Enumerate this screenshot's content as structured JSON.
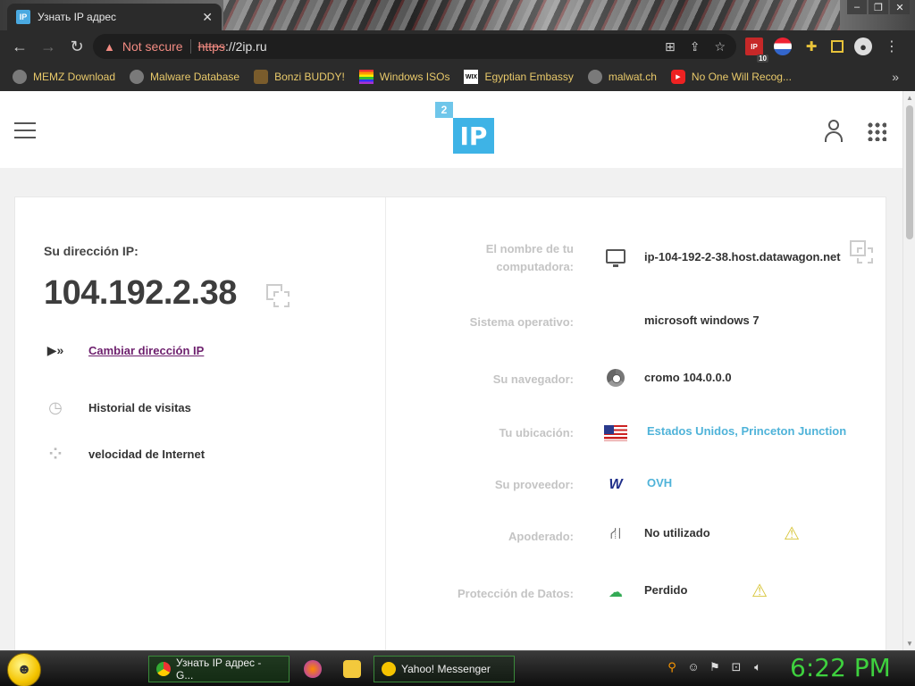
{
  "browser": {
    "tab_title": "Узнать IP адрес",
    "tab_favicon": "IP",
    "security_label": "Not secure",
    "url_scheme": "https",
    "url_rest": "://2ip.ru",
    "ext_ip_label": "IP",
    "ext_ip_badge": "10"
  },
  "bookmarks": [
    {
      "label": "MEMZ Download",
      "icon": "globe-icon"
    },
    {
      "label": "Malware Database",
      "icon": "globe-icon"
    },
    {
      "label": "Bonzi BUDDY!",
      "icon": "bonzi-icon"
    },
    {
      "label": "Windows ISOs",
      "icon": "rainbow-flag-icon"
    },
    {
      "label": "Egyptian Embassy",
      "icon": "wix-icon"
    },
    {
      "label": "malwat.ch",
      "icon": "globe-icon"
    },
    {
      "label": "No One Will Recog...",
      "icon": "youtube-icon"
    }
  ],
  "site": {
    "logo_small": "2",
    "logo_main": "IP",
    "ip_label": "Su dirección IP:",
    "ip_value": "104.192.2.38",
    "menu": {
      "change_ip": "Cambiar dirección IP",
      "history": "Historial de visitas",
      "speed": "velocidad de Internet"
    },
    "info": {
      "computer_name_label_1": "El nombre de tu",
      "computer_name_label_2": "computadora:",
      "computer_name_value": "ip-104-192-2-38.host.datawagon.net",
      "os_label": "Sistema operativo:",
      "os_value": "microsoft windows 7",
      "browser_label": "Su navegador:",
      "browser_value": "cromo 104.0.0.0",
      "location_label": "Tu ubicación:",
      "location_value": "Estados Unidos, Princeton Junction",
      "provider_label": "Su proveedor:",
      "provider_value": "OVH",
      "proxy_label": "Apoderado:",
      "proxy_value": "No utilizado",
      "data_protection_label": "Protección de Datos:",
      "data_protection_value": "Perdido"
    }
  },
  "taskbar": {
    "chrome_task": "Узнать IP адрес - G...",
    "yahoo_task": "Yahoo! Messenger",
    "clock": "6:22 PM"
  },
  "colors": {
    "link_purple": "#6d1f6d",
    "link_blue": "#4fb3d9",
    "warning_yellow": "#d8c63c",
    "clock_green": "#3ed13e",
    "brand_blue": "#3eb3e6"
  }
}
